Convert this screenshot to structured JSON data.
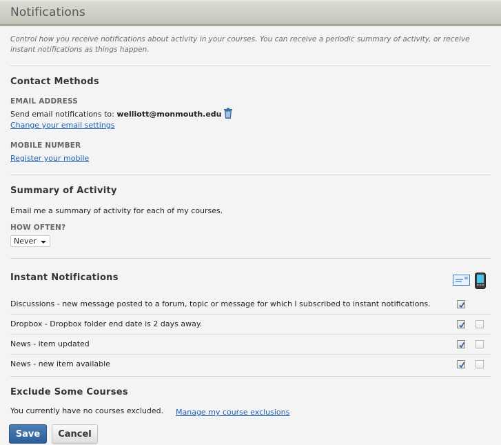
{
  "header": {
    "title": "Notifications"
  },
  "intro": "Control how you receive notifications about activity in your courses. You can receive a periodic summary of activity, or receive instant notifications as things happen.",
  "contact_methods": {
    "heading": "Contact Methods",
    "email_label": "EMAIL ADDRESS",
    "email_prefix": "Send email notifications to:",
    "email_value": "welliott@monmouth.edu",
    "delete_icon": "trash-icon",
    "change_email_link": "Change your email settings",
    "mobile_label": "MOBILE NUMBER",
    "register_mobile_link": "Register your mobile"
  },
  "summary": {
    "heading": "Summary of Activity",
    "description": "Email me a summary of activity for each of my courses.",
    "how_often_label": "HOW OFTEN?",
    "how_often_value": "Never"
  },
  "instant": {
    "heading": "Instant Notifications",
    "columns": [
      {
        "name": "email",
        "icon": "envelope-icon"
      },
      {
        "name": "mobile",
        "icon": "mobile-phone-icon"
      }
    ],
    "rows": [
      {
        "text": "Discussions - new message posted to a forum, topic or message for which I subscribed to instant notifications.",
        "email": true,
        "mobile": null
      },
      {
        "text": "Dropbox - Dropbox folder end date is 2 days away.",
        "email": true,
        "mobile": false
      },
      {
        "text": "News - item updated",
        "email": true,
        "mobile": false
      },
      {
        "text": "News - new item available",
        "email": true,
        "mobile": false
      }
    ]
  },
  "exclude": {
    "heading": "Exclude Some Courses",
    "status": "You currently have no courses excluded.",
    "manage_link": "Manage my course exclusions"
  },
  "actions": {
    "save_label": "Save",
    "cancel_label": "Cancel"
  },
  "colors": {
    "link": "#1a5fb4",
    "primary_button": "#2c5f97",
    "header_bg": "#d0d0c8"
  }
}
